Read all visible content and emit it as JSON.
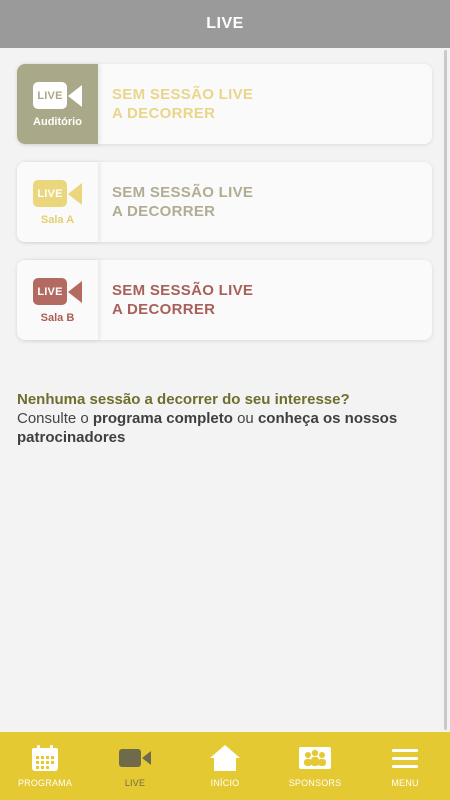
{
  "header": {
    "title": "LIVE"
  },
  "rooms": [
    {
      "live_label": "LIVE",
      "room": "Auditório",
      "status_line1": "SEM SESSÃO LIVE",
      "status_line2": "A DECORRER"
    },
    {
      "live_label": "LIVE",
      "room": "Sala A",
      "status_line1": "SEM SESSÃO LIVE",
      "status_line2": "A DECORRER"
    },
    {
      "live_label": "LIVE",
      "room": "Sala B",
      "status_line1": "SEM SESSÃO LIVE",
      "status_line2": "A DECORRER"
    }
  ],
  "info": {
    "question": "Nenhuma sessão a decorrer do seu interesse?",
    "consult": "Consulte o ",
    "program_link": "programa completo",
    "or": " ou ",
    "sponsors_link": "conheça os nossos patrocinadores"
  },
  "bottom_nav": {
    "items": [
      {
        "label": "PROGRAMA",
        "icon": "calendar-icon"
      },
      {
        "label": "LIVE",
        "icon": "video-camera-icon",
        "active": true
      },
      {
        "label": "INÍCIO",
        "icon": "home-icon"
      },
      {
        "label": "SPONSORS",
        "icon": "sponsors-icon"
      },
      {
        "label": "MENU",
        "icon": "hamburger-menu-icon"
      }
    ]
  },
  "colors": {
    "header_bg": "#9a9a9a",
    "nav_bg": "#e5c933",
    "auditorio_tile": "#a9a888",
    "sala_a_accent": "#ead77d",
    "sala_b_accent": "#b36a60"
  }
}
